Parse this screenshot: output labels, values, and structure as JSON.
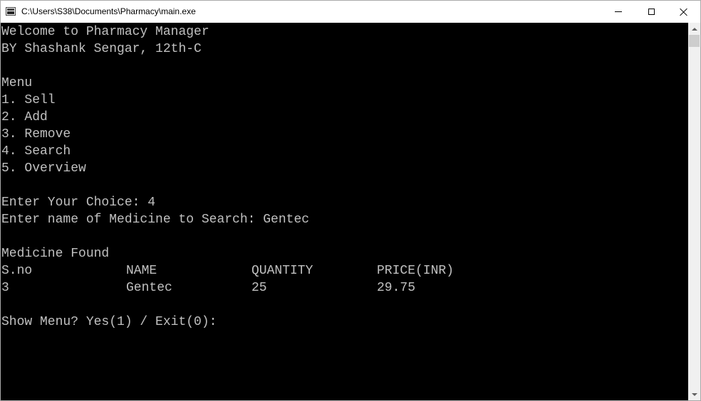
{
  "window": {
    "title": "C:\\Users\\S38\\Documents\\Pharmacy\\main.exe",
    "app_icon": "console-window-icon",
    "controls": {
      "minimize": "minimize-icon",
      "maximize": "maximize-icon",
      "close": "close-icon"
    }
  },
  "console": {
    "colors": {
      "background": "#000000",
      "text": "#c0c0c0"
    },
    "welcome": "Welcome to Pharmacy Manager",
    "author": "BY Shashank Sengar, 12th-C",
    "menu_title": "Menu",
    "menu_items": [
      "1. Sell",
      "2. Add",
      "3. Remove",
      "4. Search",
      "5. Overview"
    ],
    "choice_prompt": "Enter Your Choice: 4",
    "search_prompt": "Enter name of Medicine to Search: Gentec",
    "result_title": "Medicine Found",
    "table": {
      "headers": [
        "S.no",
        "NAME",
        "QUANTITY",
        "PRICE(INR)"
      ],
      "rows": [
        [
          "3",
          "Gentec",
          "25",
          "29.75"
        ]
      ]
    },
    "show_menu_prompt": "Show Menu? Yes(1) / Exit(0):"
  },
  "scrollbar": {
    "up_arrow": "scroll-up-arrow-icon",
    "down_arrow": "scroll-down-arrow-icon"
  }
}
